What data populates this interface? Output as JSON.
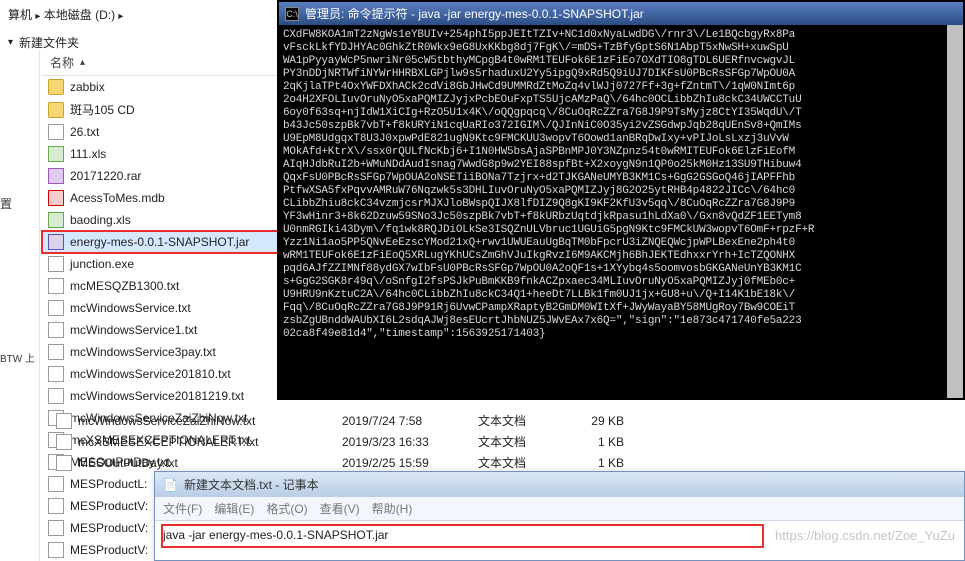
{
  "breadcrumb": {
    "segment1": "算机",
    "arrow": "▸",
    "segment2": "本地磁盘 (D:)",
    "arrow2": "▸"
  },
  "toolbar": {
    "newfolder_label": "新建文件夹"
  },
  "left": {
    "zhi": "置",
    "btw": "BTW 上"
  },
  "column_header": {
    "name": "名称"
  },
  "files": [
    {
      "icon": "folder",
      "name": "zabbix"
    },
    {
      "icon": "folder",
      "name": "斑马105 CD"
    },
    {
      "icon": "txt",
      "name": "26.txt"
    },
    {
      "icon": "xls",
      "name": "111.xls"
    },
    {
      "icon": "rar",
      "name": "20171220.rar"
    },
    {
      "icon": "mdb",
      "name": "AcessToMes.mdb"
    },
    {
      "icon": "xls",
      "name": "baoding.xls"
    },
    {
      "icon": "jar",
      "name": "energy-mes-0.0.1-SNAPSHOT.jar",
      "selected": true
    },
    {
      "icon": "txt",
      "name": "junction.exe"
    },
    {
      "icon": "txt",
      "name": "mcMESQZB1300.txt"
    },
    {
      "icon": "txt",
      "name": "mcWindowsService.txt"
    },
    {
      "icon": "txt",
      "name": "mcWindowsService1.txt"
    },
    {
      "icon": "txt",
      "name": "mcWindowsService3pay.txt"
    },
    {
      "icon": "txt",
      "name": "mcWindowsService201810.txt"
    },
    {
      "icon": "txt",
      "name": "mcWindowsService20181219.txt"
    },
    {
      "icon": "txt",
      "name": "mcWindowsServiceZaiZhiNow.txt"
    },
    {
      "icon": "txt",
      "name": "mcXSMESEXCEPTIONALERT.txt"
    },
    {
      "icon": "txt",
      "name": "MESOutPutDay.txt"
    },
    {
      "icon": "txt",
      "name": "MESProductL:"
    },
    {
      "icon": "txt",
      "name": "MESProductV:"
    },
    {
      "icon": "txt",
      "name": "MESProductV:"
    },
    {
      "icon": "txt",
      "name": "MESProductV:"
    }
  ],
  "details": [
    {
      "name": "mcWindowsServiceZaiZhiNow.txt",
      "date": "2019/7/24 7:58",
      "type": "文本文档",
      "size": "29 KB"
    },
    {
      "name": "mcXSMESEXCEPTIONALERT.txt",
      "date": "2019/3/23 16:33",
      "type": "文本文档",
      "size": "1 KB"
    },
    {
      "name": "MESOutPutDay.txt",
      "date": "2019/2/25 15:59",
      "type": "文本文档",
      "size": "1 KB"
    }
  ],
  "cmd": {
    "title": "管理员: 命令提示符 - java  -jar energy-mes-0.0.1-SNAPSHOT.jar",
    "body": "CXdFW8KOA1mT2zNgWs1eYBUIv+254phI5ppJEItTZIv+NC1d0xNyaLwdDG\\/rnr3\\/Le1BQcbgyRx8Pa\nvFsckLkfYDJHYAc0GhkZtR0Wkx9eG8UxKKbg8dj7FgK\\/=mDS+TzBfyGptS6N1AbpT5xNwSH+xuwSpU\nWA1pPyyayWcP5nwriNr05cW5tbthyMCpgB4t0wRM1TEUFok6E1zFiEo7OXdTIO8gTDL6UERfnvcwgvJL\nPY3nDDjNRTWfiNYWrHHRBXLGPjlw9s5rhaduxU2Yy5ipgQ9xRd5Q9iUJ7DIKFsU0PBcRsSFGp7WpOU0A\n2qKjlaTPt4OxYWFDXhACk2cdVi8GbJHwCd9UMMRdZtMoZq4vlWJj0727Ff+3g+fZntmT\\/1qW0NImt6p\n2o4H2XFOLIuvOruNyO5xaPQMIZJyjxPcbEOuFxpTS5UjcAMzPaQ\\/64hc0OCLibbZhIu8ckC34UWCCTuU\n6oy0f63sq+njIdW1XiCIg+RzO5U1x4K\\/oQQgpqcq\\/8CuOqRcZZra7G8J9P9TsMyjz8CtYI35WqdU\\/T\nb43Jc50szpBk7vbT+f8kURYiN1cqUaRIo372IGIM\\/QJInNiC0O35yi2vZSGdwpJqb28qUEnSv8+QmIMs\nU9EpM8UdgqxT8U3J0xpwPdE821ugN9Ktc9FMCKUU3wopvT6Oowd1anBRqDwIxy+vPIJoLsLxzj3uVvW\nMOkAfd+KtrX\\/ssx0rQULfNcKbj6+I1N0HW5bsAjaSPBnMPJ0Y3NZpnz54t0wRMITEUFok6ElzFiEofM\nAIqHJdbRuI2b+WMuNDdAudIsnag7WwdG8p9w2YEI88spfBt+X2xoygN9n1QP0o25kM0Hz13SU9THibuw4\nQqxFsU0PBcRsSFGp7WpOUA2oNSETiiBONa7Tzjrx+d2TJKGANeUMYB3KM1Cs+GgG2GSGoQ46jIAPFFhb\nPtfwXSA5fxPqvvAMRuW76Nqzwk5s3DHLIuvOruNyO5xaPQMIZJyj8G2O25ytRHB4p4822JICc\\/64hc0\nCLibbZhiu8ckC34vzmjcsrMJXJloBWspQIJX8lfDIZ9Q8gKI9KF2KfU3v5qq\\/8CuOqRcZZra7G8J9P9\nYF3wHinr3+8k62Dzuw59SNo3Jc50szpBk7vbT+f8kURbzUqtdjkRpasu1hLdXa0\\/Gxn8vQdZF1EETym8\nU0nmRGIki43Dym\\/fq1wk8RQJDiOLkSe3ISQZnULVbruc1UGUiG5pgN9Ktc9FMCkUW3wopvT6OmF+rpzF+R\nYzz1Ni1ao5PP5QNvEeEzscYMod21xQ+rwv1UWUEauUgBqTM0bFpcrU3iZNQEQWcjpWPLBexEne2ph4t0\nwRM1TEUFok6E1zFiEoQ5XRLugYKhUCsZmGhVJuIkgRvzI6M9AKCMjh6BhJEKTEdhxxrYrh+IcTZQONHX\npqd6AJfZZIMNf88ydGX7wIbFsU0PBcRsSFGp7WpOU0A2oQF1s+1XYybq4s5oomvosbGKGANeUnYB3KM1C\ns+GgG2SGK8r49q\\/oSnfgI2fsPSJkPuBmKKB9fnkACZpxaec34MLIuvOruNyO5xaPQMIZJyj0fMEb0c+\nU9HRU9nKztuC2A\\/64hc0CLibbZhIu8ckC34Q1+heeDt7LLBk1fm0UJ1jx+GU8+u\\/Q+I14K1bE18k\\/\nFqq\\/8CuOqRcZZra7G8J9P91Rj6UvwCPampXRaptyB2GmDM0WItXf+JWyWayaBY58MUgRoy7Bw9COEiT\nzsbZgUBnddWAUbXI6L2sdqAJWj8esEUcrtJhbNUZ5JWvEAx7x6Q=\",\"sign\":\"1e873c471740fe5a223\n02ca8f49e81d4\",\"timestamp\":1563925171403}"
  },
  "notepad": {
    "title": "新建文本文档.txt - 记事本",
    "menu": {
      "file": "文件(F)",
      "edit": "编辑(E)",
      "format": "格式(O)",
      "view": "查看(V)",
      "help": "帮助(H)"
    },
    "content": "java -jar energy-mes-0.0.1-SNAPSHOT.jar"
  },
  "watermark": "https://blog.csdn.net/Zoe_YuZu"
}
